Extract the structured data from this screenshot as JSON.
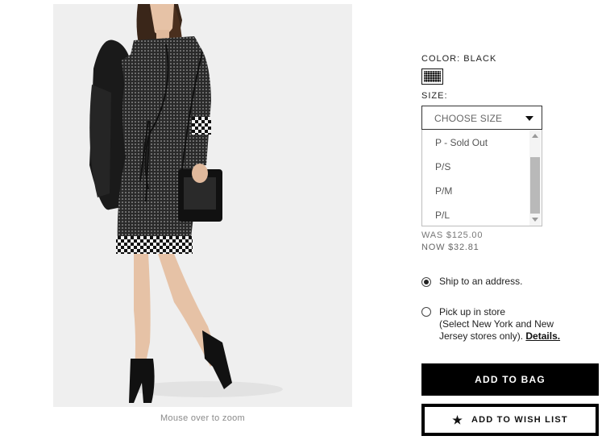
{
  "product": {
    "image_alt": "Model wearing black printed wrap dress",
    "zoom_hint": "Mouse over to zoom"
  },
  "color": {
    "label": "COLOR: BLACK",
    "swatch_color": "#222222"
  },
  "size": {
    "label": "SIZE:",
    "placeholder": "CHOOSE SIZE",
    "options": [
      "P - Sold Out",
      "P/S",
      "P/M",
      "P/L"
    ]
  },
  "price": {
    "was": "WAS $125.00",
    "now": "NOW $32.81"
  },
  "shipping": {
    "option_ship": "Ship to an address.",
    "option_pickup_line1": "Pick up in store",
    "option_pickup_line2": "(Select New York and New",
    "option_pickup_line3": "Jersey stores only).",
    "details_link": "Details.",
    "selected": "ship"
  },
  "buttons": {
    "add_to_bag": "ADD TO BAG",
    "add_to_wish_list": "ADD TO WISH LIST"
  }
}
